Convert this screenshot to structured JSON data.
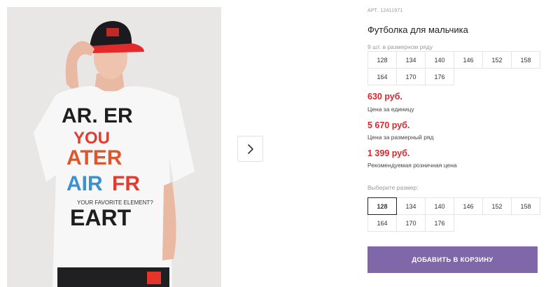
{
  "product": {
    "article_label": "АРТ.",
    "article_number": "12411971",
    "title": "Футболка для мальчика",
    "range_label": "9 шт. в размерном ряду",
    "range_sizes": [
      "128",
      "134",
      "140",
      "146",
      "152",
      "158",
      "164",
      "170",
      "176"
    ],
    "prices": [
      {
        "value": "630 руб.",
        "note": "Цена за единицу"
      },
      {
        "value": "5 670 руб.",
        "note": "Цена за размерный ряд"
      },
      {
        "value": "1 399 руб.",
        "note": "Рекомендуемая розничная цена"
      }
    ],
    "choose_size_label": "Выберите размер:",
    "size_options": [
      "128",
      "134",
      "140",
      "146",
      "152",
      "158",
      "164",
      "170",
      "176"
    ],
    "selected_size": "128",
    "add_to_cart_label": "ДОБАВИТЬ В КОРЗИНУ"
  },
  "gallery": {
    "photo_alt": "product photo: boy in white printed t-shirt and red-black cap",
    "next_icon": "chevron-right-icon"
  },
  "colors": {
    "price": "#d8262c",
    "button": "#7f67a9"
  }
}
